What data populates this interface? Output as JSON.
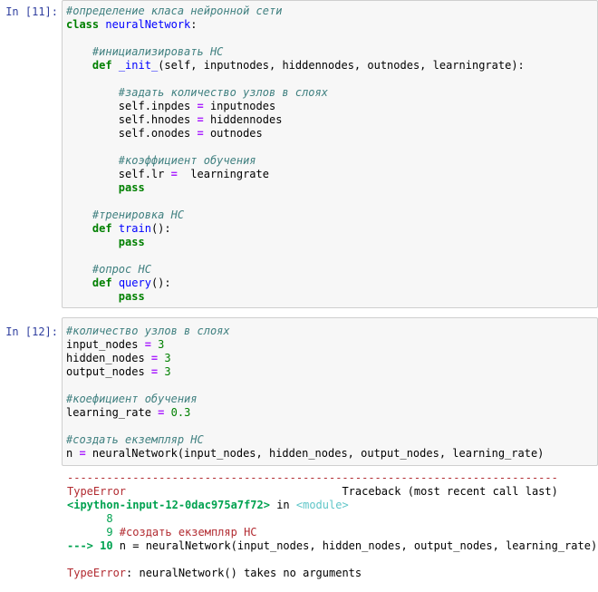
{
  "cell1": {
    "prompt": "In [11]:",
    "lines": [
      [
        {
          "t": "#определение класа нейронной сети",
          "c": "cm"
        }
      ],
      [
        {
          "t": "class",
          "c": "kw"
        },
        {
          "t": " "
        },
        {
          "t": "neuralNetwork",
          "c": "fn"
        },
        {
          "t": ":"
        }
      ],
      [
        {
          "t": ""
        }
      ],
      [
        {
          "t": "    "
        },
        {
          "t": "#инициализировать НС",
          "c": "cm"
        }
      ],
      [
        {
          "t": "    "
        },
        {
          "t": "def",
          "c": "kw"
        },
        {
          "t": " "
        },
        {
          "t": "_init_",
          "c": "fn"
        },
        {
          "t": "(self, inputnodes, hiddennodes, outnodes, learningrate):"
        }
      ],
      [
        {
          "t": ""
        }
      ],
      [
        {
          "t": "        "
        },
        {
          "t": "#задать количество узлов в слоях",
          "c": "cm"
        }
      ],
      [
        {
          "t": "        self.inpdes "
        },
        {
          "t": "=",
          "c": "op"
        },
        {
          "t": " inputnodes"
        }
      ],
      [
        {
          "t": "        self.hnodes "
        },
        {
          "t": "=",
          "c": "op"
        },
        {
          "t": " hiddennodes"
        }
      ],
      [
        {
          "t": "        self.onodes "
        },
        {
          "t": "=",
          "c": "op"
        },
        {
          "t": " outnodes"
        }
      ],
      [
        {
          "t": ""
        }
      ],
      [
        {
          "t": "        "
        },
        {
          "t": "#коэффициент обучения",
          "c": "cm"
        }
      ],
      [
        {
          "t": "        self.lr "
        },
        {
          "t": "=",
          "c": "op"
        },
        {
          "t": "  learningrate"
        }
      ],
      [
        {
          "t": "        "
        },
        {
          "t": "pass",
          "c": "kw"
        }
      ],
      [
        {
          "t": ""
        }
      ],
      [
        {
          "t": "    "
        },
        {
          "t": "#тренировка НС",
          "c": "cm"
        }
      ],
      [
        {
          "t": "    "
        },
        {
          "t": "def",
          "c": "kw"
        },
        {
          "t": " "
        },
        {
          "t": "train",
          "c": "fn"
        },
        {
          "t": "():"
        }
      ],
      [
        {
          "t": "        "
        },
        {
          "t": "pass",
          "c": "kw"
        }
      ],
      [
        {
          "t": ""
        }
      ],
      [
        {
          "t": "    "
        },
        {
          "t": "#опрос НС",
          "c": "cm"
        }
      ],
      [
        {
          "t": "    "
        },
        {
          "t": "def",
          "c": "kw"
        },
        {
          "t": " "
        },
        {
          "t": "query",
          "c": "fn"
        },
        {
          "t": "():"
        }
      ],
      [
        {
          "t": "        "
        },
        {
          "t": "pass",
          "c": "kw"
        }
      ]
    ]
  },
  "cell2": {
    "prompt": "In [12]:",
    "lines": [
      [
        {
          "t": "#количество узлов в слоях",
          "c": "cm"
        }
      ],
      [
        {
          "t": "input_nodes "
        },
        {
          "t": "=",
          "c": "op"
        },
        {
          "t": " "
        },
        {
          "t": "3",
          "c": "num"
        }
      ],
      [
        {
          "t": "hidden_nodes "
        },
        {
          "t": "=",
          "c": "op"
        },
        {
          "t": " "
        },
        {
          "t": "3",
          "c": "num"
        }
      ],
      [
        {
          "t": "output_nodes "
        },
        {
          "t": "=",
          "c": "op"
        },
        {
          "t": " "
        },
        {
          "t": "3",
          "c": "num"
        }
      ],
      [
        {
          "t": ""
        }
      ],
      [
        {
          "t": "#коефициент обучения",
          "c": "cm"
        }
      ],
      [
        {
          "t": "learning_rate "
        },
        {
          "t": "=",
          "c": "op"
        },
        {
          "t": " "
        },
        {
          "t": "0.3",
          "c": "num"
        }
      ],
      [
        {
          "t": ""
        }
      ],
      [
        {
          "t": "#создать екземпляр НС",
          "c": "cm"
        }
      ],
      [
        {
          "t": "n "
        },
        {
          "t": "=",
          "c": "op"
        },
        {
          "t": " neuralNetwork(input_nodes, hidden_nodes, output_nodes, learning_rate)"
        }
      ]
    ],
    "output_lines": [
      [
        {
          "t": "---------------------------------------------------------------------------",
          "c": "err-name"
        }
      ],
      [
        {
          "t": "TypeError",
          "c": "err-name"
        },
        {
          "t": "                                 Traceback (most recent call last)"
        }
      ],
      [
        {
          "t": "<ipython-input-12-0dac975a7f72>",
          "c": "ansi-green-bold"
        },
        {
          "t": " in "
        },
        {
          "t": "<module>",
          "c": "ansi-cyan"
        }
      ],
      [
        {
          "t": "      8",
          "c": "ansi-green"
        }
      ],
      [
        {
          "t": "      9 ",
          "c": "ansi-green"
        },
        {
          "t": "#создать екземпляр НС",
          "c": "ansi-red-line"
        }
      ],
      [
        {
          "t": "---> 10 ",
          "c": "ansi-green-bold"
        },
        {
          "t": "n "
        },
        {
          "t": "="
        },
        {
          "t": " neuralNetwork(input_nodes, hidden_nodes, output_nodes, learning_rate)"
        }
      ],
      [
        {
          "t": ""
        }
      ],
      [
        {
          "t": "TypeError",
          "c": "err-name"
        },
        {
          "t": ": neuralNetwork() takes no arguments"
        }
      ]
    ]
  }
}
